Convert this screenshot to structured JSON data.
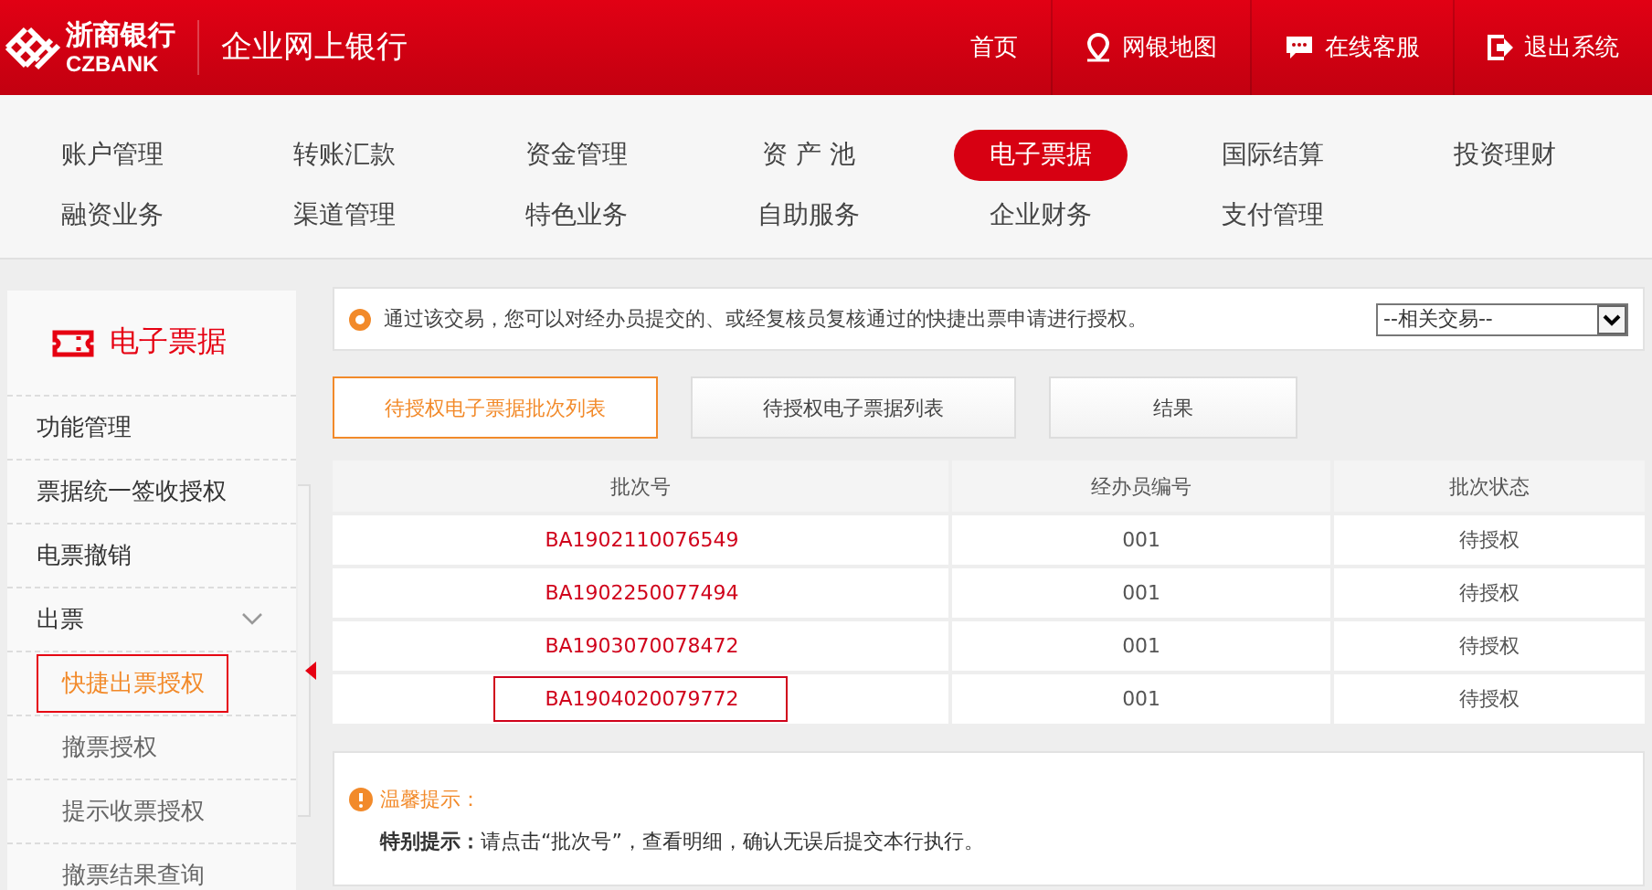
{
  "header": {
    "logo_cn": "浙商银行",
    "logo_en": "CZBANK",
    "title": "企业网上银行",
    "links": [
      {
        "kind": "home",
        "label": "首页"
      },
      {
        "kind": "map",
        "label": "网银地图"
      },
      {
        "kind": "chat",
        "label": "在线客服"
      },
      {
        "kind": "exit",
        "label": "退出系统"
      }
    ]
  },
  "menu": [
    [
      {
        "label": "账户管理",
        "selected": false
      },
      {
        "label": "转账汇款",
        "selected": false
      },
      {
        "label": "资金管理",
        "selected": false
      },
      {
        "label": "资 产 池",
        "selected": false
      },
      {
        "label": "电子票据",
        "selected": true
      },
      {
        "label": "国际结算",
        "selected": false
      },
      {
        "label": "投资理财",
        "selected": false
      }
    ],
    [
      {
        "label": "融资业务",
        "selected": false
      },
      {
        "label": "渠道管理",
        "selected": false
      },
      {
        "label": "特色业务",
        "selected": false
      },
      {
        "label": "自助服务",
        "selected": false
      },
      {
        "label": "企业财务",
        "selected": false
      },
      {
        "label": "支付管理",
        "selected": false
      }
    ]
  ],
  "sidebar": {
    "title": "电子票据",
    "items": [
      {
        "label": "功能管理",
        "selected": false
      },
      {
        "label": "票据统一签收授权",
        "selected": false
      },
      {
        "label": "电票撤销",
        "selected": false
      },
      {
        "label": "出票",
        "selected": false,
        "expanded": true,
        "children": [
          {
            "label": "快捷出票授权",
            "selected": true
          },
          {
            "label": "撤票授权",
            "selected": false
          },
          {
            "label": "提示收票授权",
            "selected": false
          },
          {
            "label": "撤票结果查询",
            "selected": false
          }
        ]
      }
    ]
  },
  "notice": {
    "text": "通过该交易，您可以对经办员提交的、或经复核员复核通过的快捷出票申请进行授权。",
    "select": "--相关交易--"
  },
  "tabs": [
    {
      "label": "待授权电子票据批次列表",
      "selected": true
    },
    {
      "label": "待授权电子票据列表",
      "selected": false
    },
    {
      "label": "结果",
      "selected": false
    }
  ],
  "table": {
    "columns": [
      "批次号",
      "经办员编号",
      "批次状态"
    ],
    "rows": [
      {
        "batch": "BA1902110076549",
        "operator": "001",
        "status": "待授权",
        "selected": false
      },
      {
        "batch": "BA1902250077494",
        "operator": "001",
        "status": "待授权",
        "selected": false
      },
      {
        "batch": "BA1903070078472",
        "operator": "001",
        "status": "待授权",
        "selected": false
      },
      {
        "batch": "BA1904020079772",
        "operator": "001",
        "status": "待授权",
        "selected": true
      }
    ]
  },
  "tips": {
    "title": "温馨提示：",
    "text": "**特别提示：**请点击“批次号”，查看明细，确认无误后提交本行执行。"
  }
}
